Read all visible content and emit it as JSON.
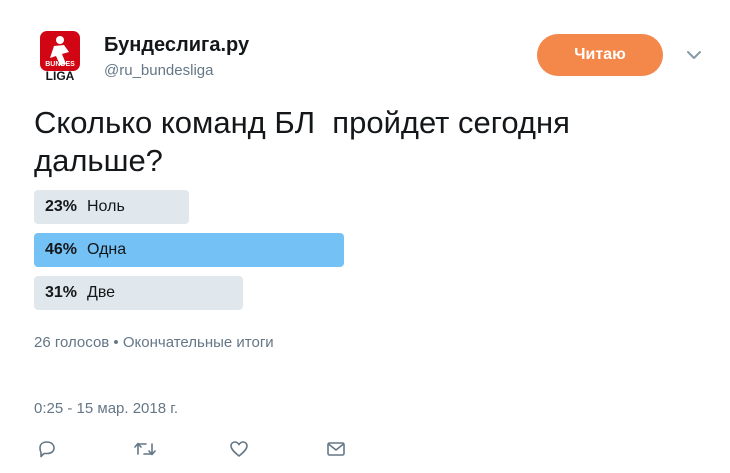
{
  "account": {
    "name": "Бундеслига.ру",
    "handle": "@ru_bundesliga",
    "logo_text_top": "BUNDES",
    "logo_text_bottom": "LIGA"
  },
  "follow_button": {
    "label": "Читаю"
  },
  "tweet": {
    "text": "Сколько команд БЛ  пройдет сегодня\nдальше?"
  },
  "poll": {
    "options": [
      {
        "percent": "23%",
        "label": "Ноль",
        "fraction": 0.23,
        "winner": false
      },
      {
        "percent": "46%",
        "label": "Одна",
        "fraction": 0.46,
        "winner": true
      },
      {
        "percent": "31%",
        "label": "Две",
        "fraction": 0.31,
        "winner": false
      }
    ],
    "votes": "26 голосов",
    "separator": "•",
    "status": "Окончательные итоги"
  },
  "timestamp": "0:25 - 15 мар. 2018 г.",
  "icons": {
    "reply": "reply-icon",
    "retweet": "retweet-icon",
    "like": "heart-icon",
    "message": "envelope-icon",
    "caret": "chevron-down-icon"
  },
  "colors": {
    "accent": "#f4874a",
    "poll_winner": "#74c1f5",
    "poll_other": "#e1e8ed",
    "muted_text": "#657786",
    "logo_red": "#d20515"
  }
}
